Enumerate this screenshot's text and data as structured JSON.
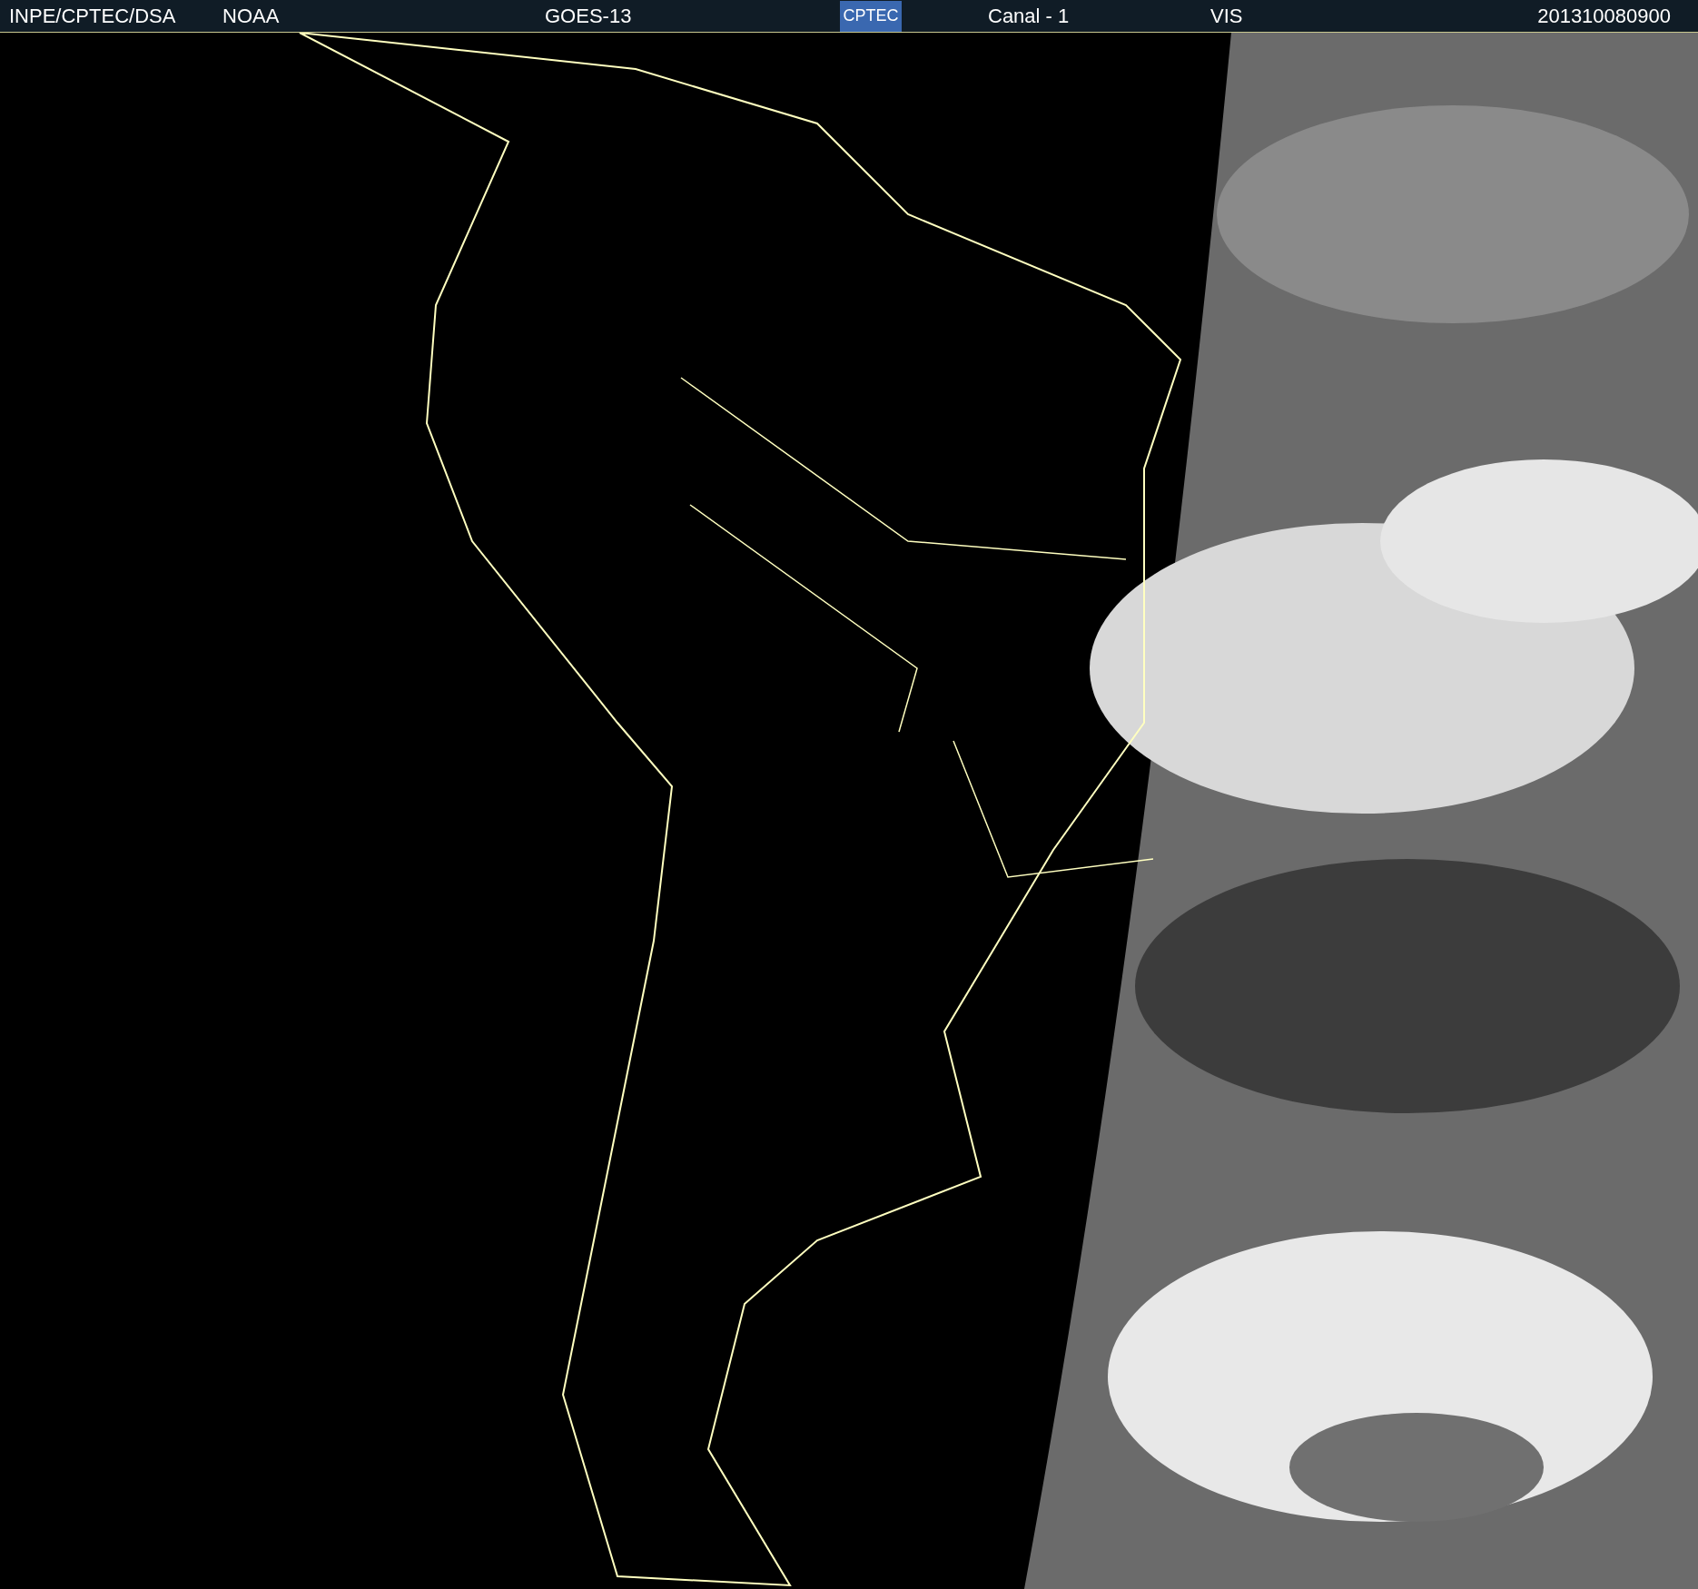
{
  "header": {
    "source": "INPE/CPTEC/DSA",
    "agency": "NOAA",
    "satellite": "GOES-13",
    "logo": "CPTEC",
    "channel": "Canal - 1",
    "band": "VIS",
    "timestamp": "201310080900"
  }
}
